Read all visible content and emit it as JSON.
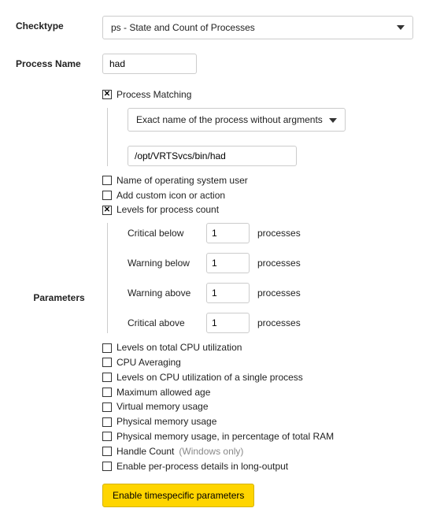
{
  "checktype": {
    "label": "Checktype",
    "value": "ps - State and Count of Processes"
  },
  "process_name": {
    "label": "Process Name",
    "value": "had"
  },
  "parameters": {
    "label": "Parameters",
    "process_matching": {
      "label": "Process Matching",
      "checked": true,
      "mode": "Exact name of the process without argments",
      "path": "/opt/VRTSvcs/bin/had"
    },
    "os_user": {
      "label": "Name of operating system user",
      "checked": false
    },
    "custom_icon": {
      "label": "Add custom icon or action",
      "checked": false
    },
    "levels_count": {
      "label": "Levels for process count",
      "checked": true,
      "unit": "processes",
      "rows": [
        {
          "label": "Critical below",
          "value": "1"
        },
        {
          "label": "Warning below",
          "value": "1"
        },
        {
          "label": "Warning above",
          "value": "1"
        },
        {
          "label": "Critical above",
          "value": "1"
        }
      ]
    },
    "extra": [
      {
        "label": "Levels on total CPU utilization",
        "checked": false
      },
      {
        "label": "CPU Averaging",
        "checked": false
      },
      {
        "label": "Levels on CPU utilization of a single process",
        "checked": false
      },
      {
        "label": "Maximum allowed age",
        "checked": false
      },
      {
        "label": "Virtual memory usage",
        "checked": false
      },
      {
        "label": "Physical memory usage",
        "checked": false
      },
      {
        "label": "Physical memory usage, in percentage of total RAM",
        "checked": false
      },
      {
        "label": "Handle Count",
        "note": "(Windows only)",
        "checked": false
      },
      {
        "label": "Enable per-process details in long-output",
        "checked": false
      }
    ],
    "timespecific_btn": "Enable timespecific parameters"
  }
}
